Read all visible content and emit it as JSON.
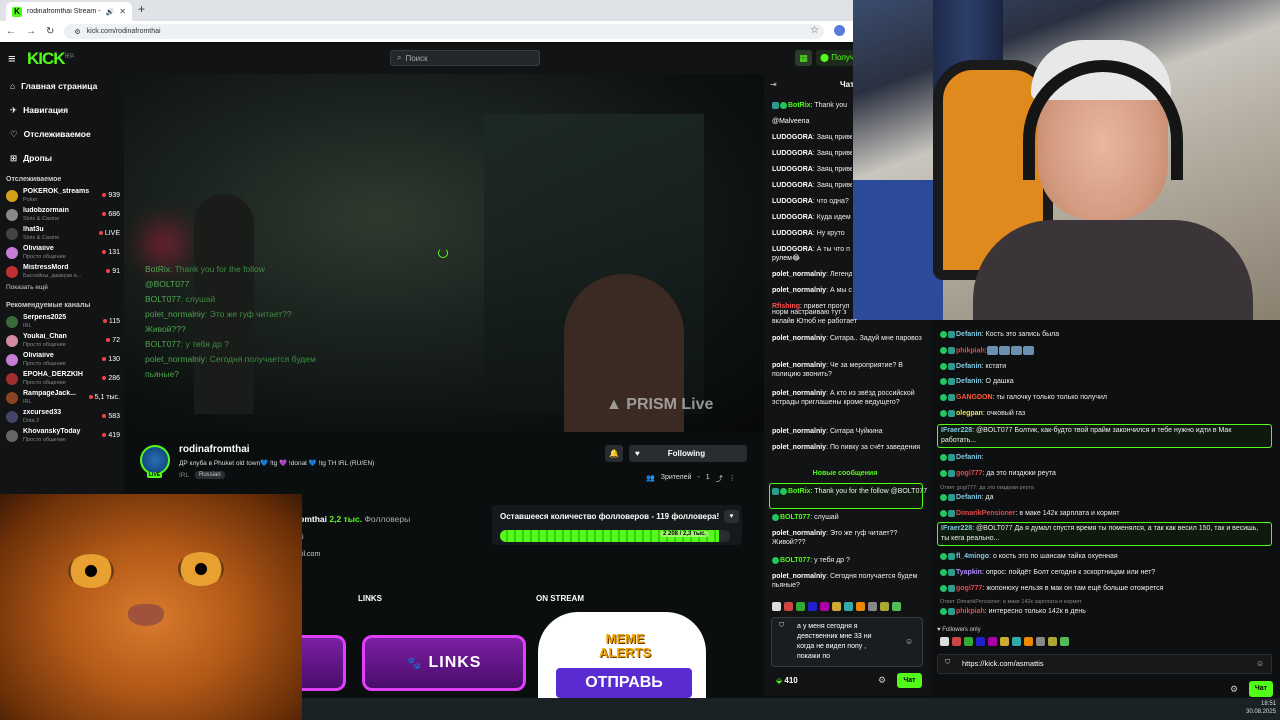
{
  "browser": {
    "tab_title": "rodinafromthai Stream - W",
    "url": "kick.com/rodinafromthai"
  },
  "header": {
    "logo": "KICK",
    "logo_sup": "BETA",
    "search_placeholder": "Поиск",
    "get_button": "Получ"
  },
  "sidebar": {
    "nav": [
      {
        "label": "Главная страница",
        "icon": "home-icon"
      },
      {
        "label": "Навигация",
        "icon": "compass-icon"
      },
      {
        "label": "Отслеживаемое",
        "icon": "heart-icon"
      },
      {
        "label": "Дропы",
        "icon": "gift-icon"
      }
    ],
    "following_header": "Отслеживаемое",
    "following": [
      {
        "name": "POKEROK_streams",
        "category": "Poker",
        "viewers": "939",
        "color": "#d4a017"
      },
      {
        "name": "ludobzormain",
        "category": "Slots & Casino",
        "viewers": "686",
        "color": "#888888"
      },
      {
        "name": "lhat3u",
        "category": "Slots & Casino",
        "viewers": "LIVE",
        "color": "#444444"
      },
      {
        "name": "Oliviaiive",
        "category": "Просто общение",
        "viewers": "131",
        "color": "#c77dd6"
      },
      {
        "name": "MistressMord",
        "category": "Бассейны, джакузи и...",
        "viewers": "91",
        "color": "#c03030"
      }
    ],
    "show_more": "Показать ещё",
    "recommended_header": "Рекомендуемые каналы",
    "recommended": [
      {
        "name": "Serpens2025",
        "category": "IRL",
        "viewers": "115",
        "color": "#3a6a3a"
      },
      {
        "name": "Youkai_Chan",
        "category": "Просто общение",
        "viewers": "72",
        "color": "#d48aa0"
      },
      {
        "name": "Oliviaiive",
        "category": "Просто общение",
        "viewers": "130",
        "color": "#c77dd6"
      },
      {
        "name": "EPOHA_DERZKIH",
        "category": "Просто общение",
        "viewers": "286",
        "color": "#a03030"
      },
      {
        "name": "RampageJack...",
        "category": "IRL",
        "viewers": "5,1 тыс.",
        "color": "#884422"
      },
      {
        "name": "zxcursed33",
        "category": "Dota 2",
        "viewers": "583",
        "color": "#444466"
      },
      {
        "name": "KhovanskyToday",
        "category": "Просто общение",
        "viewers": "419",
        "color": "#666666"
      }
    ]
  },
  "video": {
    "overlay_chat": [
      {
        "user": "BotRix",
        "text": ": Thank you for the follow"
      },
      {
        "user": "@BOLT077",
        "text": ""
      },
      {
        "user": "BOLT077",
        "text": ": слушай"
      },
      {
        "user": "polet_normalniy",
        "text": ": Это же гуф читает??"
      },
      {
        "user": "Живой???",
        "text": ""
      },
      {
        "user": "BOLT077",
        "text": ": у тебя др ?"
      },
      {
        "user": "polet_normalniy",
        "text": ": Сегодня получается будем"
      },
      {
        "user": "пьяные?",
        "text": ""
      }
    ],
    "watermark": "PRISM Live"
  },
  "channel": {
    "name": "rodinafromthai",
    "description": "ДР клуба в Phuket old town💙 !tg 💜 !donat 💙 !tg TH IRL (RU/EN)",
    "category": "IRL",
    "language": "Russian",
    "follow_label": "Following",
    "viewers_label": "Зрителей",
    "viewers_count": "1"
  },
  "about": {
    "name": "rodinafromthai",
    "followers_count": "2,2 тыс.",
    "followers_label": "Фолловеры",
    "line1": "i",
    "line2": "il.com"
  },
  "goal": {
    "title": "Оставшееся количество фолловеров - 119 фолловера!",
    "progress_label": "2 208 / 2,3 тыс.",
    "progress": 0.95
  },
  "panels": {
    "links_header": "LINKS",
    "onstream_header": "ON STREAM",
    "links_banner": "LINKS",
    "meme_title": "MEME ALERTS",
    "meme_button": "ОТПРАВЬ"
  },
  "kick_chat": {
    "title": "Чат",
    "top_messages": [
      {
        "user": "BotRix",
        "text": ": Thank you",
        "bot": true
      },
      {
        "user": "@Malveena",
        "text": "",
        "plain": true
      },
      {
        "user": "LUDOGORA",
        "text": ": Заяц приве"
      },
      {
        "user": "LUDOGORA",
        "text": ": Заяц приве"
      },
      {
        "user": "LUDOGORA",
        "text": ": Заяц приве"
      },
      {
        "user": "LUDOGORA",
        "text": ": Заяц приве"
      },
      {
        "user": "LUDOGORA",
        "text": ": что одна?"
      },
      {
        "user": "LUDOGORA",
        "text": ": Куда идем"
      },
      {
        "user": "LUDOGORA",
        "text": ": Ну круто"
      },
      {
        "user": "LUDOGORA",
        "text": ": А ты что п"
      },
      {
        "user": "рулем😂",
        "text": "",
        "plain": true
      },
      {
        "user": "polet_normalniy",
        "text": ": Легенд"
      },
      {
        "user": "polet_normalniy",
        "text": ": А мы с"
      },
      {
        "user": "Rfishing",
        "text": ": привет прогул",
        "red": true
      }
    ],
    "messages": [
      {
        "user": "",
        "text": "норм настраиваю тут з"
      },
      {
        "user": "",
        "text": "вклайв Ютюб не работает"
      },
      {
        "user": "polet_normalniy",
        "text": ": Ситара.. Задуй мне паровоз"
      },
      {
        "user": "polet_normalniy",
        "text": ": Че за мероприятие? В полицию звонить?"
      },
      {
        "user": "polet_normalniy",
        "text": ": А кто из звёзд российской эстрады приглашены кроме ведущего?"
      },
      {
        "user": "polet_normalniy",
        "text": ": Ситара Чуйкина"
      },
      {
        "user": "polet_normalniy",
        "text": ": По пивку за счёт заведения"
      }
    ],
    "new_messages": "Новые сообщения",
    "pinned_user": "BotRix",
    "pinned_text": ": Thank you for the follow @BOLT077",
    "after": [
      {
        "user": "BOLT077",
        "text": ": слушай",
        "green": true
      },
      {
        "user": "polet_normalniy",
        "text": ": Это же гуф читает?? Живой???"
      },
      {
        "user": "BOLT077",
        "text": ": у тебя др ?",
        "green": true
      },
      {
        "user": "polet_normalniy",
        "text": ": Сегодня получается будем пьяные?"
      }
    ],
    "input_text": "а у меня сегодня я девственник мне 33 ни когда не видел попу , покажи по",
    "points": "410",
    "send_button": "Чат"
  },
  "right_chat": {
    "messages": [
      {
        "user": "Defanin",
        "text": ": Кость это запись была",
        "color": "#7ec8e3"
      },
      {
        "user": "phikpiah",
        "text": ":",
        "color": "#e34a4a",
        "emotes": 4
      },
      {
        "user": "Defanin",
        "text": ": кстати",
        "color": "#7ec8e3"
      },
      {
        "user": "Defanin",
        "text": ": О дашка",
        "color": "#7ec8e3"
      },
      {
        "user": "GANGDON",
        "text": ": ты галочку только только получил",
        "color": "#ff5a36"
      },
      {
        "user": "olegpan",
        "text": ": очковый газ",
        "color": "#e6e64a"
      }
    ],
    "highlight1": {
      "user": "IFraer228",
      "text": ": @BOLT077 Болтик, как-будто твой прайм закончился и тебе нужно идти в Мак работать..."
    },
    "messages2": [
      {
        "user": "Defanin",
        "text": ":",
        "color": "#7ec8e3"
      },
      {
        "user": "gogi777",
        "text": ": да это пиздюки реута",
        "color": "#e34a4a"
      },
      {
        "user": "Defanin",
        "text": ": да",
        "color": "#7ec8e3"
      },
      {
        "user": "DimarikPensioner",
        "text": ": в маке 142к зарплата и кормят",
        "color": "#e34a4a"
      }
    ],
    "reply1": "Ответ gogi777: да это пиздюки реута",
    "highlight2": {
      "user": "IFraer228",
      "text": ": @BOLT077 Да я думал спустя время ты поменялся, а так как весил 150, так и весишь, ты кега реально..."
    },
    "messages3": [
      {
        "user": "fl_4mingo",
        "text": ": о кость это по шансам тайка охуенная",
        "color": "#7ec8e3"
      },
      {
        "user": "Tyapkin",
        "text": ": опрос: пойдёт Болт сегодня к эскортницам или нет?",
        "color": "#b58aff"
      },
      {
        "user": "gogi777",
        "text": ": жопонюху нельзя в мак он там ещё больше отожрется",
        "color": "#e34a4a"
      },
      {
        "user": "phikpiah",
        "text": ": интересно только 142к в день",
        "color": "#e34a4a"
      }
    ],
    "reply2": "Ответ DimarikPensioner: в маке 142к зарплата и кормят",
    "followers_only": "Followers only",
    "input_text": "https://kick.com/asmattis",
    "send_button": "Чат"
  },
  "taskbar": {
    "time": "18:51",
    "date": "30.08.2025"
  },
  "colors": {
    "accent": "#53fc18",
    "bg": "#0b0e0f",
    "panel": "#111315"
  }
}
